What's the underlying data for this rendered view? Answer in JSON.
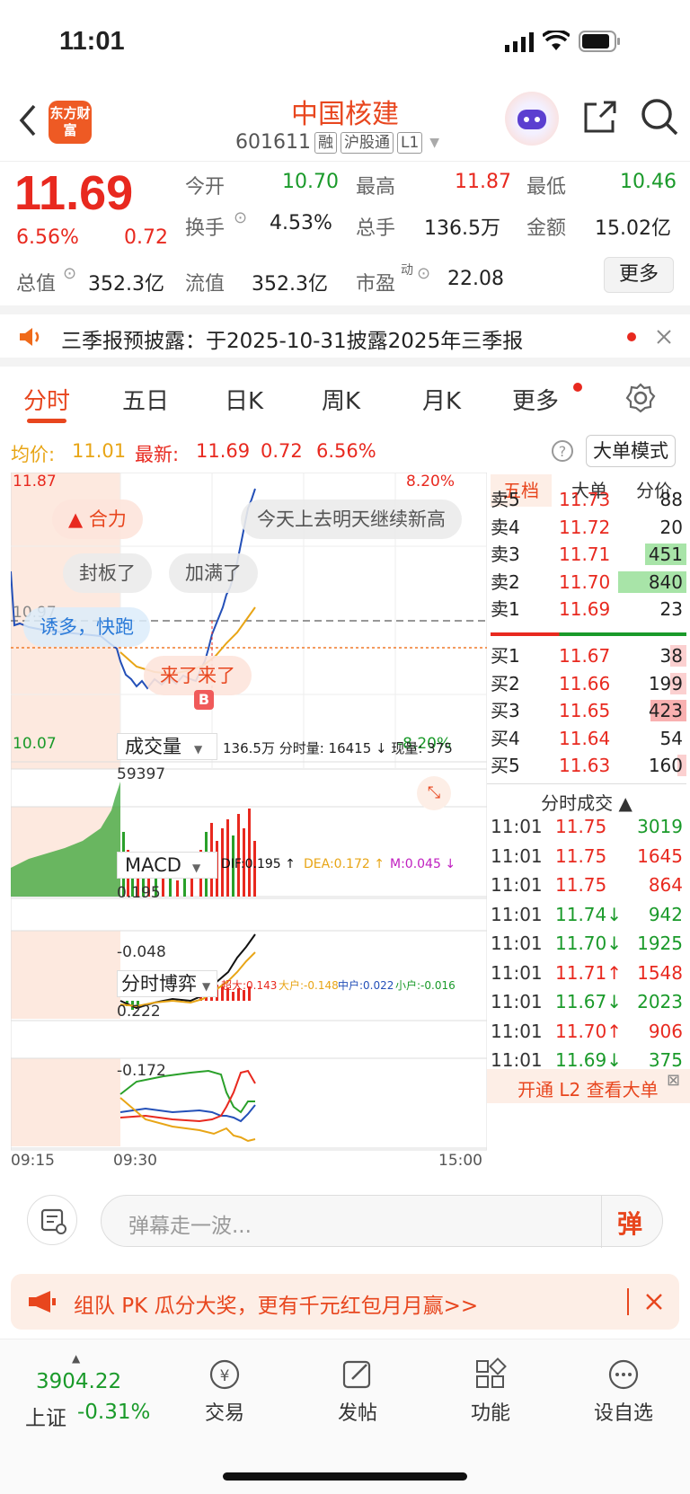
{
  "status": {
    "time": "11:01"
  },
  "header": {
    "logo": "东方财富",
    "name": "中国核建",
    "code": "601611",
    "tags": [
      "融",
      "沪股通",
      "L1"
    ]
  },
  "quote": {
    "price": "11.69",
    "pct": "6.56%",
    "chg": "0.72",
    "zongzhi_label": "总值",
    "zongzhi": "352.3亿",
    "open_label": "今开",
    "open": "10.70",
    "high_label": "最高",
    "high": "11.87",
    "low_label": "最低",
    "low": "10.46",
    "turnover_label": "换手",
    "turnover": "4.53%",
    "vol_label": "总手",
    "vol": "136.5万",
    "amount_label": "金额",
    "amount": "15.02亿",
    "liuzhi_label": "流值",
    "liuzhi": "352.3亿",
    "pe_label": "市盈",
    "pe_sup": "动",
    "pe": "22.08",
    "more": "更多"
  },
  "notice": {
    "text": "三季报预披露：于2025-10-31披露2025年三季报"
  },
  "tabs": [
    "分时",
    "五日",
    "日K",
    "周K",
    "月K",
    "更多"
  ],
  "legend": {
    "avg_label": "均价:",
    "avg": "11.01",
    "last_label": "最新:",
    "last": "11.69",
    "chg": "0.72",
    "pct": "6.56%",
    "mode": "大单模式"
  },
  "chart": {
    "y_top": "11.87",
    "y_bottom": "10.07",
    "pct_top": "8.20%",
    "pct_bottom": "-8.20%",
    "y_mid": "10.97",
    "bubbles": [
      "合力",
      "今天上去明天继续新高",
      "封板了",
      "加满了",
      "诱多，快跑",
      "来了来了"
    ],
    "buy_marker": "B",
    "vol_title": "成交量",
    "vol_info": "136.5万 分时量: 16415 ↓ 现量: 375",
    "vol_max": "59397",
    "macd_title": "MACD",
    "dif": "DIF:0.195 ↑",
    "dea": "DEA:0.172 ↑",
    "m": "M:0.045 ↓",
    "macd_top": "0.195",
    "macd_bottom": "-0.048",
    "game_title": "分时博弈",
    "game_big": "超大:0.143",
    "game_large": "大户:-0.148",
    "game_mid": "中户:0.022",
    "game_small": "小户:-0.016",
    "game_top": "0.222",
    "game_bottom": "-0.172",
    "t_start": "09:15",
    "t_mid": "09:30",
    "t_end": "15:00"
  },
  "orderbook": {
    "tabs": [
      "五档",
      "大单",
      "分价"
    ],
    "asks": [
      {
        "l": "卖5",
        "p": "11.73",
        "v": "88"
      },
      {
        "l": "卖4",
        "p": "11.72",
        "v": "20"
      },
      {
        "l": "卖3",
        "p": "11.71",
        "v": "451"
      },
      {
        "l": "卖2",
        "p": "11.70",
        "v": "840"
      },
      {
        "l": "卖1",
        "p": "11.69",
        "v": "23"
      }
    ],
    "bids": [
      {
        "l": "买1",
        "p": "11.67",
        "v": "38"
      },
      {
        "l": "买2",
        "p": "11.66",
        "v": "199"
      },
      {
        "l": "买3",
        "p": "11.65",
        "v": "423"
      },
      {
        "l": "买4",
        "p": "11.64",
        "v": "54"
      },
      {
        "l": "买5",
        "p": "11.63",
        "v": "160"
      }
    ],
    "ticks_title": "分时成交 ▲",
    "ticks": [
      {
        "t": "11:01",
        "p": "11.75",
        "v": "3019"
      },
      {
        "t": "11:01",
        "p": "11.75",
        "v": "1645"
      },
      {
        "t": "11:01",
        "p": "11.75",
        "v": "864"
      },
      {
        "t": "11:01",
        "p": "11.74↓",
        "v": "942"
      },
      {
        "t": "11:01",
        "p": "11.70↓",
        "v": "1925"
      },
      {
        "t": "11:01",
        "p": "11.71↑",
        "v": "1548"
      },
      {
        "t": "11:01",
        "p": "11.67↓",
        "v": "2023"
      },
      {
        "t": "11:01",
        "p": "11.70↑",
        "v": "906"
      },
      {
        "t": "11:01",
        "p": "11.69↓",
        "v": "375"
      }
    ],
    "l2": "开通 L2 查看大单"
  },
  "danmu": {
    "placeholder": "弹幕走一波...",
    "btn": "弹"
  },
  "banner": {
    "text": "组队 PK 瓜分大奖，更有千元红包月月赢>>"
  },
  "bottomnav": {
    "index_value": "3904.22",
    "index_name": "上证",
    "index_pct": "-0.31%",
    "items": [
      "交易",
      "发帖",
      "功能",
      "设自选"
    ]
  }
}
